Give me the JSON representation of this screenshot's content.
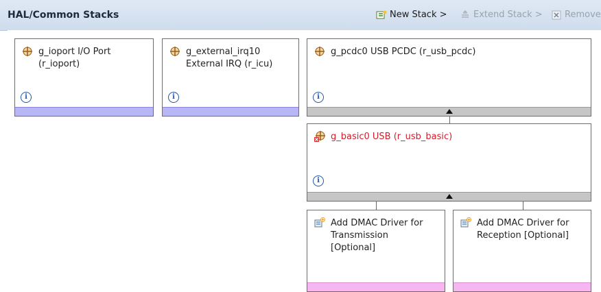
{
  "header": {
    "title": "HAL/Common Stacks",
    "new_stack": "New Stack >",
    "extend_stack": "Extend Stack >",
    "remove": "Remove"
  },
  "modules": [
    {
      "line1": "g_ioport I/O Port",
      "line2": "(r_ioport)",
      "icon": "module-icon"
    },
    {
      "line1": "g_external_irq10",
      "line2": "External IRQ (r_icu)",
      "icon": "module-icon"
    },
    {
      "line1": "g_pcdc0 USB PCDC (r_usb_pcdc)",
      "icon": "module-icon"
    },
    {
      "line1": "g_basic0 USB (r_usb_basic)",
      "icon": "module-error-icon",
      "color": "#d11e2d"
    }
  ],
  "add_drivers": [
    {
      "line1": "Add DMAC Driver for",
      "line2": "Transmission",
      "line3": "[Optional]"
    },
    {
      "line1": "Add DMAC Driver for",
      "line2": "Reception [Optional]"
    }
  ],
  "info_symbol": "i",
  "colors": {
    "blue_bar": "#b9b6f7",
    "gray_bar": "#c6c6c6",
    "pink_bar": "#f6b7f1",
    "error_text": "#d11e2d"
  }
}
